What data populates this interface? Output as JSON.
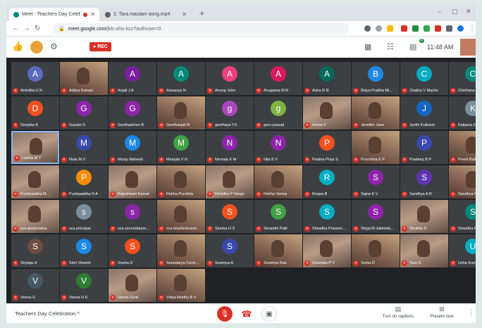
{
  "browser": {
    "tabs": [
      {
        "title": "Meet - Teachers Day Celebr...",
        "fav_color": "#00897b",
        "recording_dot": "#d93025"
      },
      {
        "title": "2. Tara maslam song.mp4",
        "fav_color": "#5f6368"
      }
    ],
    "address": {
      "host": "meet.google.com/",
      "path": "jkb-uhis-kcz?authuser=0"
    }
  },
  "meet": {
    "rec_label": "REC",
    "time": "11:48 AM",
    "chat_badge": "8",
    "meeting_name": "Teachers Day Celebration",
    "captions_label": "Turn on captions",
    "present_label": "Present now"
  },
  "participants": [
    {
      "name": "Anindita U N",
      "type": "avatar",
      "letter": "A",
      "color": "#5c6bc0"
    },
    {
      "name": "Aditya Kumari",
      "type": "video"
    },
    {
      "name": "Anjali J A",
      "type": "avatar",
      "letter": "A",
      "color": "#7b1fa2"
    },
    {
      "name": "Aiswarya N",
      "type": "avatar",
      "letter": "A",
      "color": "#00897b"
    },
    {
      "name": "Anoop John",
      "type": "avatar",
      "letter": "A",
      "color": "#ec407a"
    },
    {
      "name": "Anupama M R",
      "type": "avatar",
      "letter": "A",
      "color": "#d81b60"
    },
    {
      "name": "Asha R R",
      "type": "avatar",
      "letter": "A",
      "color": "#00695c"
    },
    {
      "name": "Bidya Prabha Mi...",
      "type": "avatar",
      "letter": "B",
      "color": "#1e88e5"
    },
    {
      "name": "Chaitra V Machu",
      "type": "avatar",
      "letter": "C",
      "color": "#00acc1"
    },
    {
      "name": "Chethana R",
      "type": "avatar",
      "letter": "C",
      "color": "#00897b"
    },
    {
      "name": "Deepika K",
      "type": "avatar",
      "letter": "D",
      "color": "#f4511e"
    },
    {
      "name": "Gayatri S",
      "type": "avatar",
      "letter": "G",
      "color": "#8e24aa"
    },
    {
      "name": "Geethashree B",
      "type": "avatar",
      "letter": "G",
      "color": "#8e24aa"
    },
    {
      "name": "Geethanjali R",
      "type": "video"
    },
    {
      "name": "geethaya YS",
      "type": "avatar",
      "letter": "g",
      "color": "#ab47bc"
    },
    {
      "name": "guru prasad",
      "type": "avatar",
      "letter": "g",
      "color": "#7cb342"
    },
    {
      "name": "Hema V",
      "type": "video"
    },
    {
      "name": "Jennifer Jane",
      "type": "video"
    },
    {
      "name": "Jyothi Kulkarni",
      "type": "avatar",
      "letter": "J",
      "color": "#1565c0"
    },
    {
      "name": "Kalpana C",
      "type": "avatar",
      "letter": "K",
      "color": "#78909c"
    },
    {
      "name": "Lalitha M T",
      "type": "video",
      "self": true
    },
    {
      "name": "Mala M V",
      "type": "avatar",
      "letter": "M",
      "color": "#3949ab"
    },
    {
      "name": "Manju Mahesh",
      "type": "avatar",
      "letter": "M",
      "color": "#1e88e5"
    },
    {
      "name": "Manjula V N",
      "type": "avatar",
      "letter": "M",
      "color": "#43a047"
    },
    {
      "name": "Nirmala K M",
      "type": "avatar",
      "letter": "N",
      "color": "#8e24aa"
    },
    {
      "name": "Nila B V",
      "type": "avatar",
      "letter": "N",
      "color": "#8e24aa"
    },
    {
      "name": "Padma Priya S",
      "type": "avatar",
      "letter": "P",
      "color": "#f4511e"
    },
    {
      "name": "Poornima K P",
      "type": "video"
    },
    {
      "name": "Pradeep B P",
      "type": "avatar",
      "letter": "P",
      "color": "#3949ab"
    },
    {
      "name": "Preeti Ballary",
      "type": "video"
    },
    {
      "name": "Pushpalatha M...",
      "type": "video"
    },
    {
      "name": "Pushpalatha N A",
      "type": "avatar",
      "letter": "P",
      "color": "#fb8c00"
    },
    {
      "name": "Rajeshwari Kamat",
      "type": "video"
    },
    {
      "name": "Rekha Purohita",
      "type": "video"
    },
    {
      "name": "Renjitha P Vargis",
      "type": "video"
    },
    {
      "name": "Rekha Varma",
      "type": "video"
    },
    {
      "name": "Roopa B",
      "type": "avatar",
      "letter": "R",
      "color": "#00acc1"
    },
    {
      "name": "Sajna K V",
      "type": "avatar",
      "letter": "S",
      "color": "#8e24aa"
    },
    {
      "name": "Sandhya A R",
      "type": "avatar",
      "letter": "S",
      "color": "#5e35b1"
    },
    {
      "name": "Sandhya Naik",
      "type": "video"
    },
    {
      "name": "sca geepmatna",
      "type": "video"
    },
    {
      "name": "sca principal",
      "type": "avatar",
      "letter": "s",
      "color": "#78909c"
    },
    {
      "name": "sca secondarysc...",
      "type": "avatar",
      "letter": "s",
      "color": "#8e24aa"
    },
    {
      "name": "sca teacherboard...",
      "type": "video"
    },
    {
      "name": "Seema H S",
      "type": "avatar",
      "letter": "S",
      "color": "#f4511e"
    },
    {
      "name": "Sevanthi Patil",
      "type": "avatar",
      "letter": "S",
      "color": "#43a047"
    },
    {
      "name": "Shwetha Praveen...",
      "type": "avatar",
      "letter": "S",
      "color": "#00acc1"
    },
    {
      "name": "Shyja M Jakhnda...",
      "type": "avatar",
      "letter": "S",
      "color": "#8e24aa"
    },
    {
      "name": "Shubha S",
      "type": "video"
    },
    {
      "name": "Shwetha R",
      "type": "avatar",
      "letter": "S",
      "color": "#00897b"
    },
    {
      "name": "Shylaja H",
      "type": "avatar",
      "letter": "S",
      "color": "#6d4c41"
    },
    {
      "name": "Simi Vineeth",
      "type": "avatar",
      "letter": "S",
      "color": "#1e88e5"
    },
    {
      "name": "Sneha D",
      "type": "avatar",
      "letter": "S",
      "color": "#f4511e"
    },
    {
      "name": "Soundarya Centr...",
      "type": "video"
    },
    {
      "name": "Sowmya A",
      "type": "avatar",
      "letter": "S",
      "color": "#3949ab"
    },
    {
      "name": "Sowmya Rao",
      "type": "video"
    },
    {
      "name": "Sreekala P V",
      "type": "video"
    },
    {
      "name": "Suma D",
      "type": "video"
    },
    {
      "name": "Tara G",
      "type": "video"
    },
    {
      "name": "Usha Kumari V",
      "type": "avatar",
      "letter": "U",
      "color": "#00acc1"
    },
    {
      "name": "Veena G",
      "type": "avatar",
      "letter": "V",
      "color": "#455a64"
    },
    {
      "name": "Veena H S",
      "type": "avatar",
      "letter": "V",
      "color": "#2e7d32"
    },
    {
      "name": "Veena Sunil",
      "type": "video"
    },
    {
      "name": "Vidya Murthy B V",
      "type": "video"
    }
  ]
}
